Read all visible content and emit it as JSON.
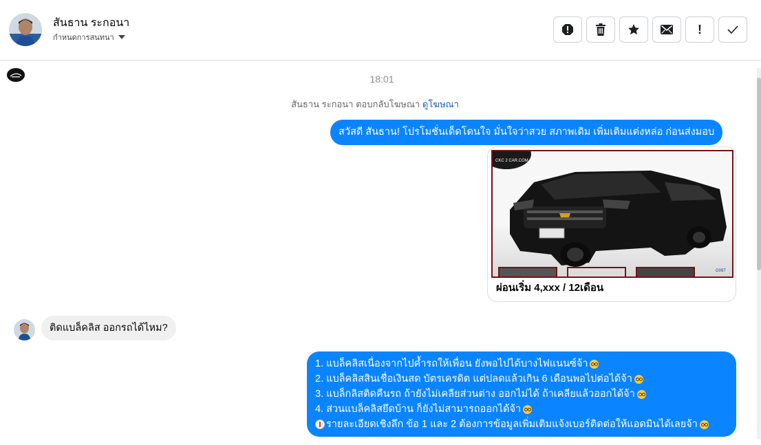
{
  "header": {
    "contact_name": "สันธาน ระกอนา",
    "subtitle": "กำหนดการสนทนา",
    "actions": [
      {
        "name": "report-icon"
      },
      {
        "name": "trash-icon"
      },
      {
        "name": "star-icon"
      },
      {
        "name": "mail-icon"
      },
      {
        "name": "exclamation-icon",
        "label": "!"
      },
      {
        "name": "check-icon"
      }
    ]
  },
  "chat": {
    "timestamp": "18:01",
    "ad_reply": {
      "text": "สันธาน ระกอนา ตอบกลับโฆษณา",
      "link": "ดูโฆษณา"
    },
    "messages": {
      "greeting": "สวัสดี สันธาน! โปรโมชั่นเด็ดโดนใจ มั่นใจว่าสวย สภาพเดิม เพิ่มเติมแต่งหล่อ ก่อนส่งมอบ",
      "card": {
        "title": "ผ่อนเริ่ม 4,xxx / 12เดือน",
        "brand": "CKC 2 CAR.COM",
        "stock_code": "G097"
      },
      "customer_question": "ติดแบล็คลิส ออกรถได้ไหม?",
      "reply_lines": [
        "1. แบล็คลิสเนื่องจากไปค้ำรถให้เพื่อน ยังพอไปได้บางไฟแนนซ์จ้า",
        "2. แบล็คลิสสินเชื่อเงินสด บัตรเครดิต แต่ปลดแล้วเกิน 6 เดือนพอไปต่อได้จ้า",
        "3. แบล็กลิสติดคืนรถ ถ้ายังไม่เคลียส่วนต่าง ออกไม่ได้ ถ้าเคลียแล้วออกได้จ้า",
        "4. ส่วนแบล็คลิสยึดบ้าน ก็ยังไม่สามารถออกได้จ้า",
        "รายละเอียดเชิงลึก ข้อ 1 และ 2 ต้องการข้อมูลเพิ่มเติมแจ้งเบอร์ติดต่อให้แอดมินได้เลยจ้า"
      ]
    }
  },
  "colors": {
    "outgoing_bubble": "#0b84ff",
    "incoming_bubble": "#f0f0f0",
    "link": "#1b5fc1",
    "card_frame": "#7a1010"
  }
}
